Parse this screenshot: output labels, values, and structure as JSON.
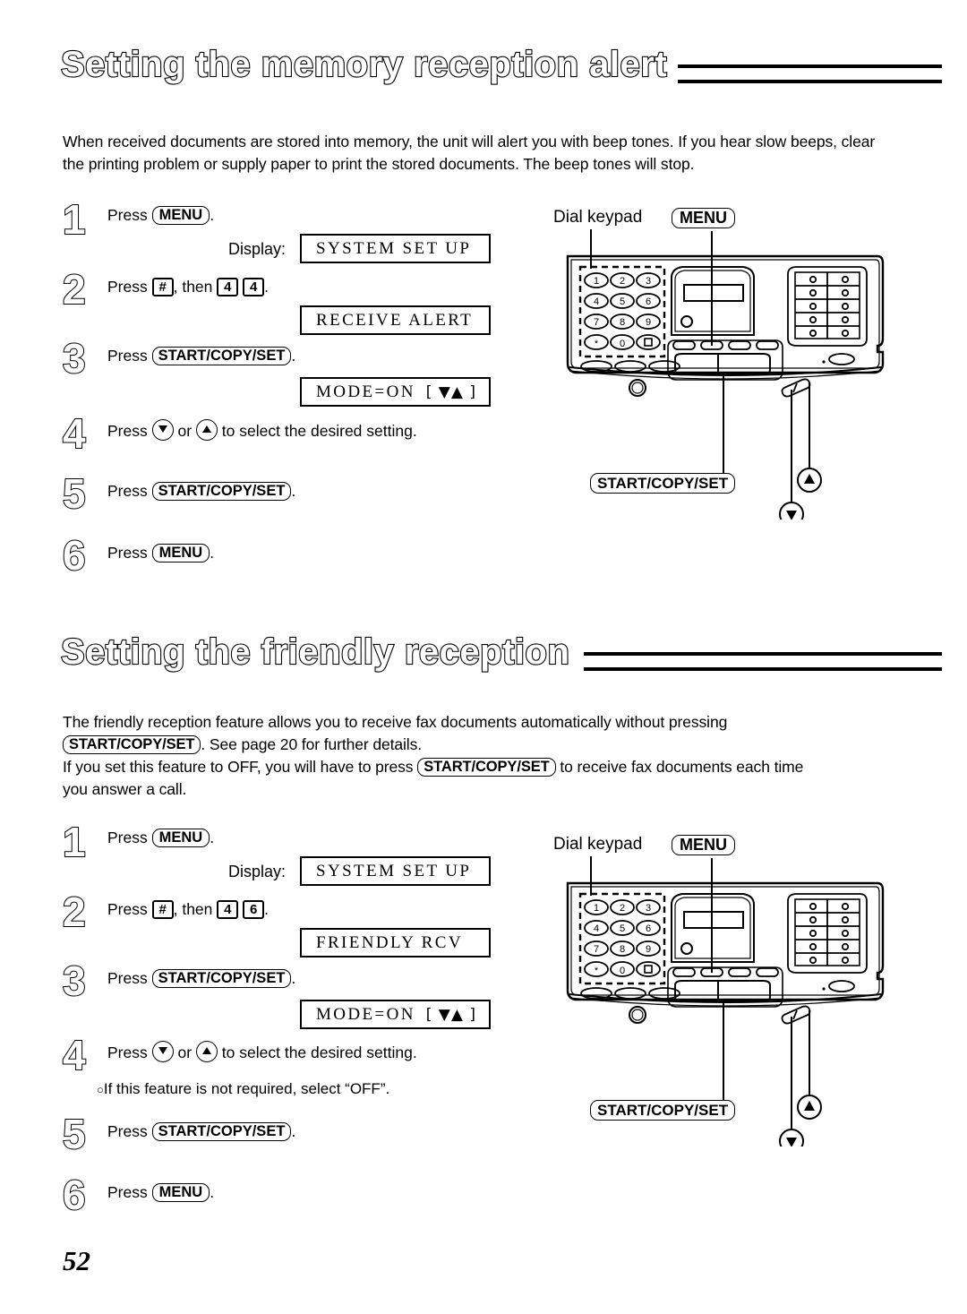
{
  "page": {
    "number": "52"
  },
  "sections": [
    {
      "id": "memory-reception-alert",
      "title": "Setting the memory reception alert",
      "intro": "When received documents are stored into memory, the unit will alert you with beep tones. If you hear slow beeps, clear the printing problem or supply paper to print the stored documents. The beep tones will stop.",
      "steps": [
        {
          "number": "1",
          "text_before": "Press",
          "key": "MENU",
          "text_after": "."
        },
        {
          "number": "2",
          "text_before": "Press",
          "key": "#",
          "mid": ", then",
          "digit1": "4",
          "digit2": "4",
          "text_after": "."
        },
        {
          "number": "3",
          "text_before": "Press",
          "key": "START/COPY/SET",
          "text_after": "."
        },
        {
          "number": "4",
          "text_before": "Press",
          "down": "▽",
          "or": "or",
          "up": "△",
          "text_after": "to select the desired setting."
        },
        {
          "number": "5",
          "text_before": "Press",
          "key": "START/COPY/SET",
          "text_after": "."
        },
        {
          "number": "6",
          "text_before": "Press",
          "key": "MENU",
          "text_after": "."
        }
      ],
      "display_label": "Display:",
      "displays": [
        {
          "text": "SYSTEM SET UP",
          "arrows": ""
        },
        {
          "text": "RECEIVE ALERT",
          "arrows": ""
        },
        {
          "text": "MODE=ON",
          "arrows": "[ ▼▲ ]"
        }
      ],
      "diagram": {
        "dial_keypad_label": "Dial keypad",
        "menu_label": "MENU",
        "start_label": "START/COPY/SET",
        "keypad_keys": [
          "1",
          "2",
          "3",
          "4",
          "5",
          "6",
          "7",
          "8",
          "9",
          "*",
          "0",
          "#"
        ]
      }
    },
    {
      "id": "friendly-reception",
      "title": "Setting the friendly reception",
      "intro_line1": "The friendly reception feature allows you to receive fax documents automatically without pressing",
      "intro_key1": "START/COPY/SET",
      "intro_line2": ". See page 20 for further details.",
      "intro_line3a": "If you set this feature to OFF, you will have to press",
      "intro_key2": "START/COPY/SET",
      "intro_line3b": "to receive fax documents each time",
      "intro_line4": "you answer a call.",
      "steps": [
        {
          "number": "1",
          "text_before": "Press",
          "key": "MENU",
          "text_after": "."
        },
        {
          "number": "2",
          "text_before": "Press",
          "key": "#",
          "mid": ", then",
          "digit1": "4",
          "digit2": "6",
          "text_after": "."
        },
        {
          "number": "3",
          "text_before": "Press",
          "key": "START/COPY/SET",
          "text_after": "."
        },
        {
          "number": "4",
          "text_before": "Press",
          "down": "▽",
          "or": "or",
          "up": "△",
          "text_after": "to select the desired setting."
        },
        {
          "number": "5",
          "text_before": "Press",
          "key": "START/COPY/SET",
          "text_after": "."
        },
        {
          "number": "6",
          "text_before": "Press",
          "key": "MENU",
          "text_after": "."
        }
      ],
      "note": "If this feature is not required, select “OFF”.",
      "display_label": "Display:",
      "displays": [
        {
          "text": "SYSTEM SET UP",
          "arrows": ""
        },
        {
          "text": "FRIENDLY RCV",
          "arrows": ""
        },
        {
          "text": "MODE=ON",
          "arrows": "[ ▼▲ ]"
        }
      ],
      "diagram": {
        "dial_keypad_label": "Dial keypad",
        "menu_label": "MENU",
        "start_label": "START/COPY/SET",
        "keypad_keys": [
          "1",
          "2",
          "3",
          "4",
          "5",
          "6",
          "7",
          "8",
          "9",
          "*",
          "0",
          "#"
        ]
      }
    }
  ]
}
